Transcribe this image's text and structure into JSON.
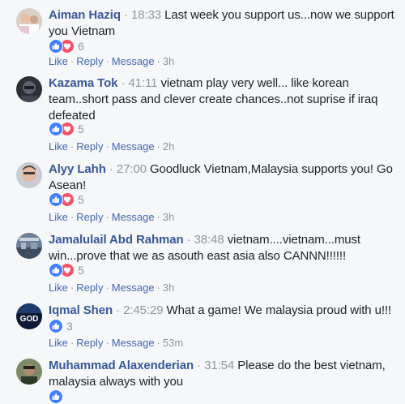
{
  "comments": [
    {
      "author": "Aiman Haziq",
      "time": "18:33",
      "text": "Last week you support us...now we support you Vietnam",
      "reactions": [
        "like",
        "love"
      ],
      "count": "6",
      "like": "Like",
      "reply": "Reply",
      "message": "Message",
      "ago": "3h"
    },
    {
      "author": "Kazama Tok",
      "time": "41:11",
      "text": "vietnam play very well... like korean team..short pass and clever create chances..not suprise if iraq defeated",
      "reactions": [
        "like",
        "love"
      ],
      "count": "5",
      "like": "Like",
      "reply": "Reply",
      "message": "Message",
      "ago": "2h"
    },
    {
      "author": "Alyy Lahh",
      "time": "27:00",
      "text": "Goodluck Vietnam,Malaysia supports you! Go Asean!",
      "reactions": [
        "like",
        "love"
      ],
      "count": "5",
      "like": "Like",
      "reply": "Reply",
      "message": "Message",
      "ago": "3h"
    },
    {
      "author": "Jamalulail Abd Rahman",
      "time": "38:48",
      "text": "vietnam....vietnam...must win...prove that we as asouth east asia also CANNN!!!!!!",
      "reactions": [
        "like",
        "love"
      ],
      "count": "5",
      "like": "Like",
      "reply": "Reply",
      "message": "Message",
      "ago": "3h"
    },
    {
      "author": "Iqmal Shen",
      "time": "2:45:29",
      "text": "What a game! We malaysia proud with u!!!",
      "reactions": [
        "like"
      ],
      "count": "3",
      "like": "Like",
      "reply": "Reply",
      "message": "Message",
      "ago": "53m",
      "avatar_text": "GOD"
    },
    {
      "author": "Muhammad Alaxenderian",
      "time": "31:54",
      "text": "Please do the best vietnam, malaysia always with you",
      "reactions": [
        "like"
      ],
      "count": "",
      "like": "",
      "reply": "",
      "message": "",
      "ago": ""
    }
  ],
  "separator": "·",
  "colors": {
    "link": "#365899",
    "muted": "#90949c",
    "like": "#4080ff",
    "love": "#f25268",
    "background": "#f6f7f9"
  }
}
